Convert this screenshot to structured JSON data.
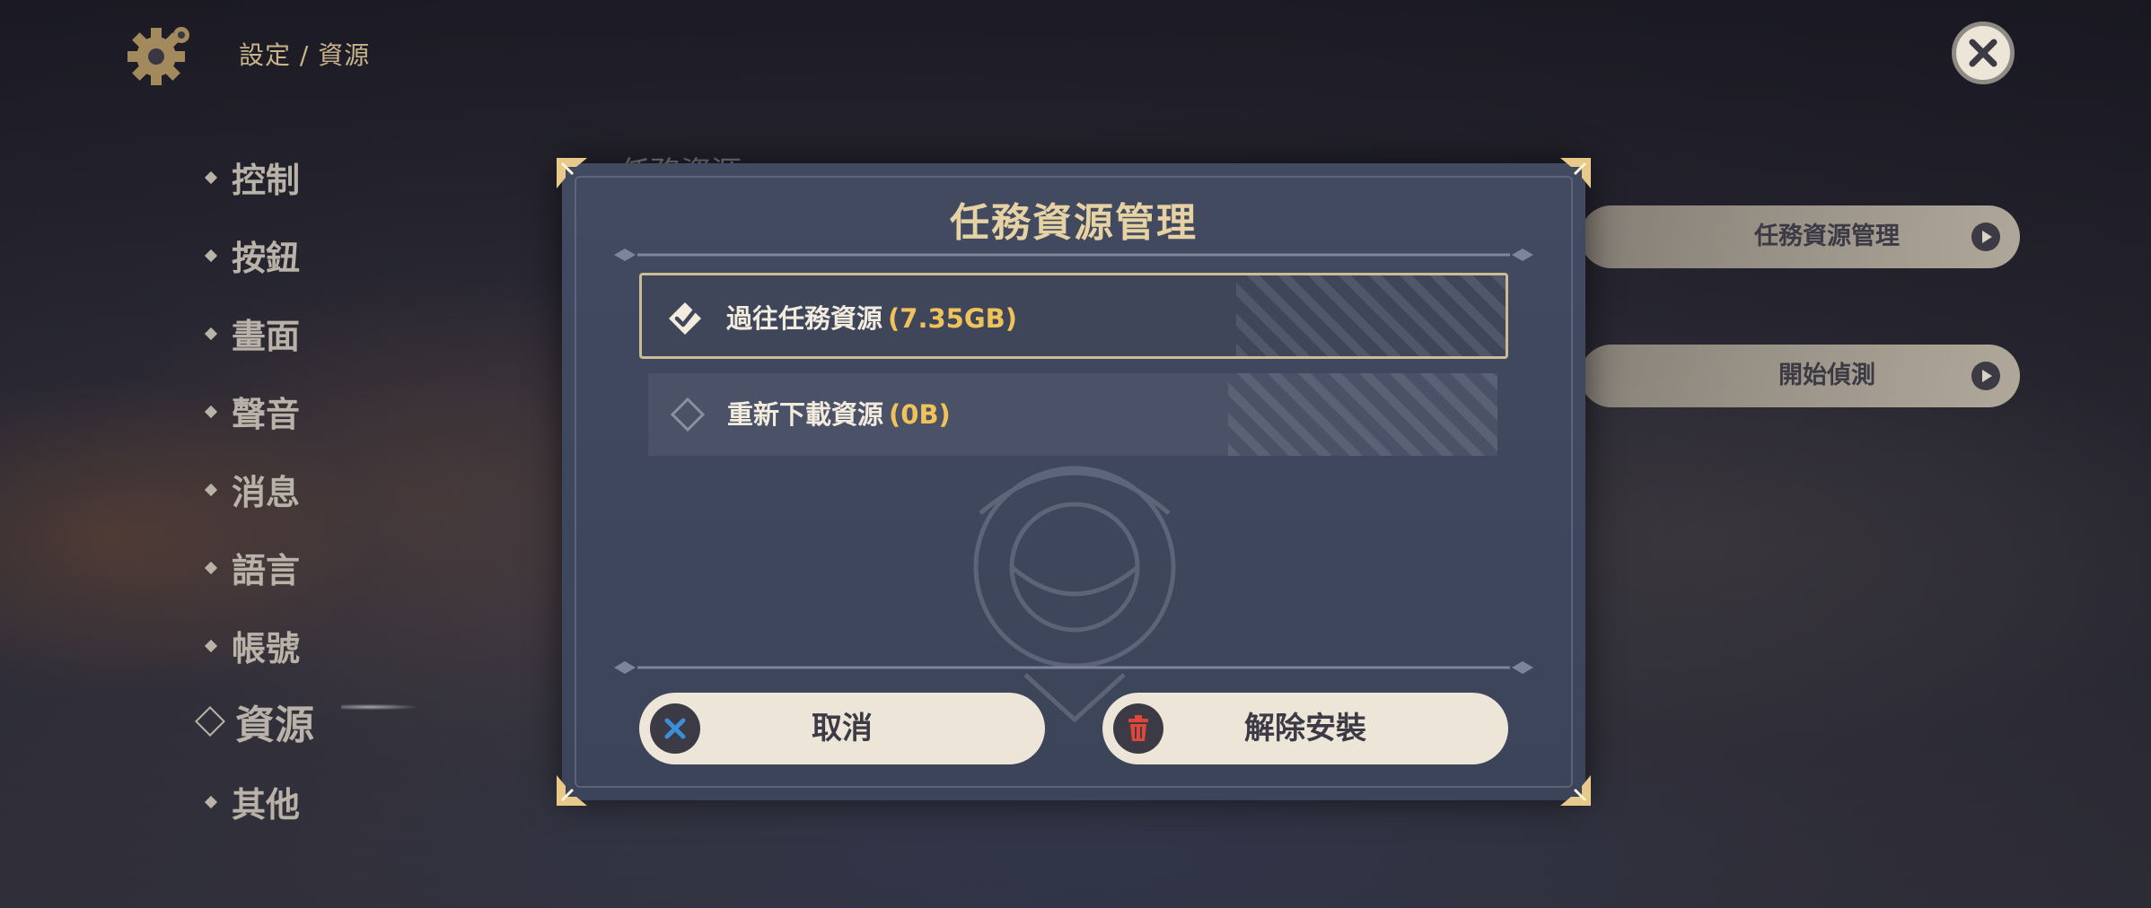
{
  "header": {
    "breadcrumb": "設定 / 資源"
  },
  "sidebar": {
    "items": [
      {
        "label": "控制"
      },
      {
        "label": "按鈕"
      },
      {
        "label": "畫面"
      },
      {
        "label": "聲音"
      },
      {
        "label": "消息"
      },
      {
        "label": "語言"
      },
      {
        "label": "帳號"
      },
      {
        "label": "資源",
        "active": true
      },
      {
        "label": "其他"
      }
    ]
  },
  "background_panel": {
    "section_title": "任務資源",
    "buttons": [
      {
        "label": "任務資源管理"
      },
      {
        "label": "開始偵測"
      }
    ]
  },
  "dialog": {
    "title": "任務資源管理",
    "options": [
      {
        "label": "過往任務資源",
        "size": "(7.35GB)",
        "selected": true
      },
      {
        "label": "重新下載資源",
        "size": "(0B)",
        "selected": false
      }
    ],
    "cancel_label": "取消",
    "uninstall_label": "解除安裝"
  },
  "colors": {
    "accent_gold": "#e6d2a2",
    "size_yellow": "#f0c35a",
    "button_bg": "#ece5d8",
    "cancel_icon": "#3a8fd6",
    "delete_icon": "#e0463a"
  },
  "icons": [
    "gear-icon",
    "close-icon",
    "check-icon",
    "delete-icon"
  ]
}
